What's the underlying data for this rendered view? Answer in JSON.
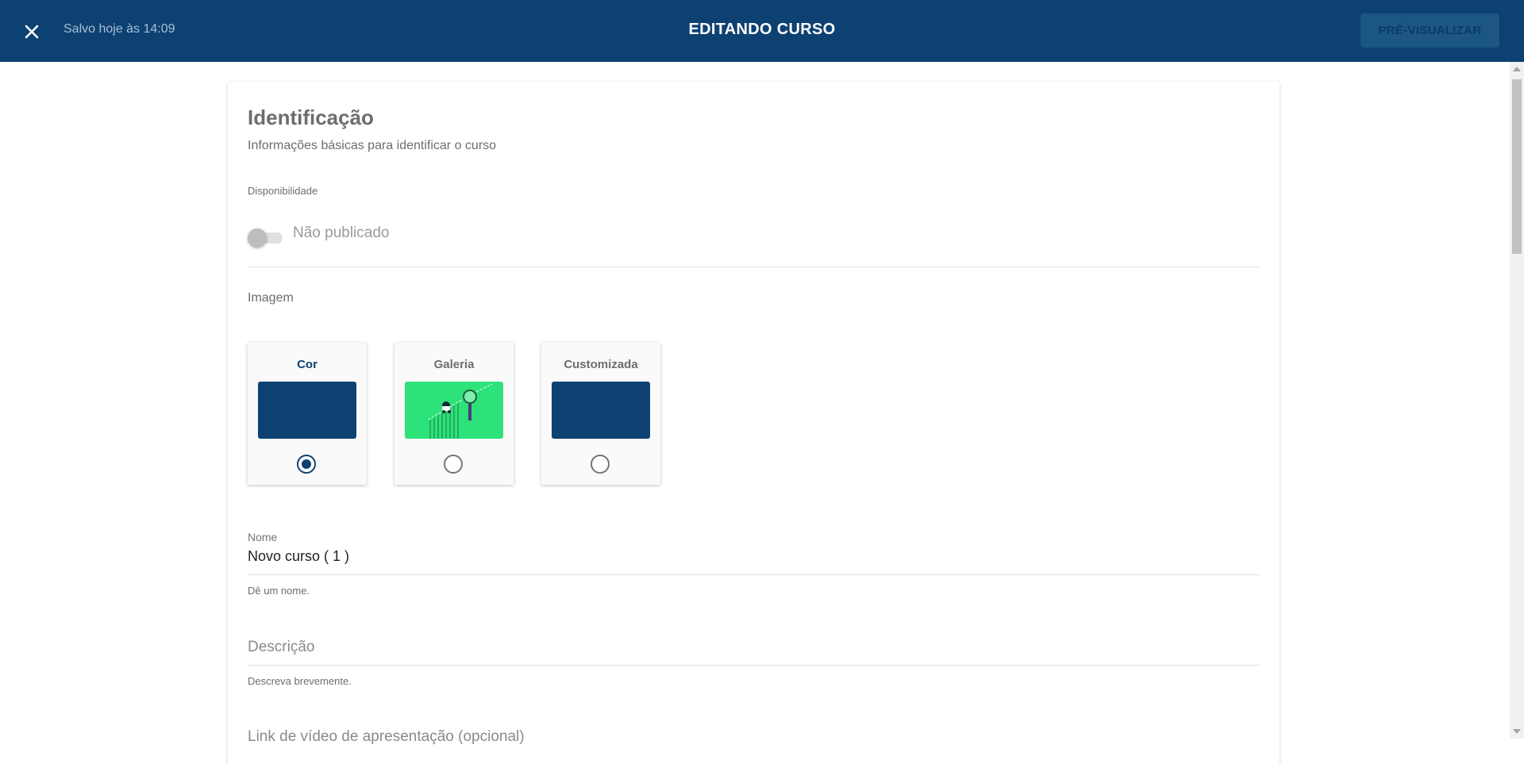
{
  "header": {
    "saved_status": "Salvo hoje às 14:09",
    "title": "EDITANDO CURSO",
    "preview_label": "PRÉ-VISUALIZAR",
    "close_icon": "close-icon"
  },
  "identification": {
    "title": "Identificação",
    "subtitle": "Informações básicas para identificar o curso",
    "availability_label": "Disponibilidade",
    "availability_value": "Não publicado",
    "published": false
  },
  "image": {
    "label": "Imagem",
    "options": [
      {
        "title": "Cor",
        "selected": true,
        "color": "#0d4172"
      },
      {
        "title": "Galeria",
        "selected": false,
        "color": "#2ecc71"
      },
      {
        "title": "Customizada",
        "selected": false,
        "color": "#0d4172"
      }
    ]
  },
  "fields": {
    "name_label": "Nome",
    "name_value": "Novo curso ( 1 )",
    "name_help": "Dê um nome.",
    "description_placeholder": "Descrição",
    "description_help": "Descreva brevemente.",
    "video_placeholder": "Link de vídeo de apresentação (opcional)"
  },
  "colors": {
    "primary": "#0d4172",
    "gallery_green": "#2ee27a"
  }
}
